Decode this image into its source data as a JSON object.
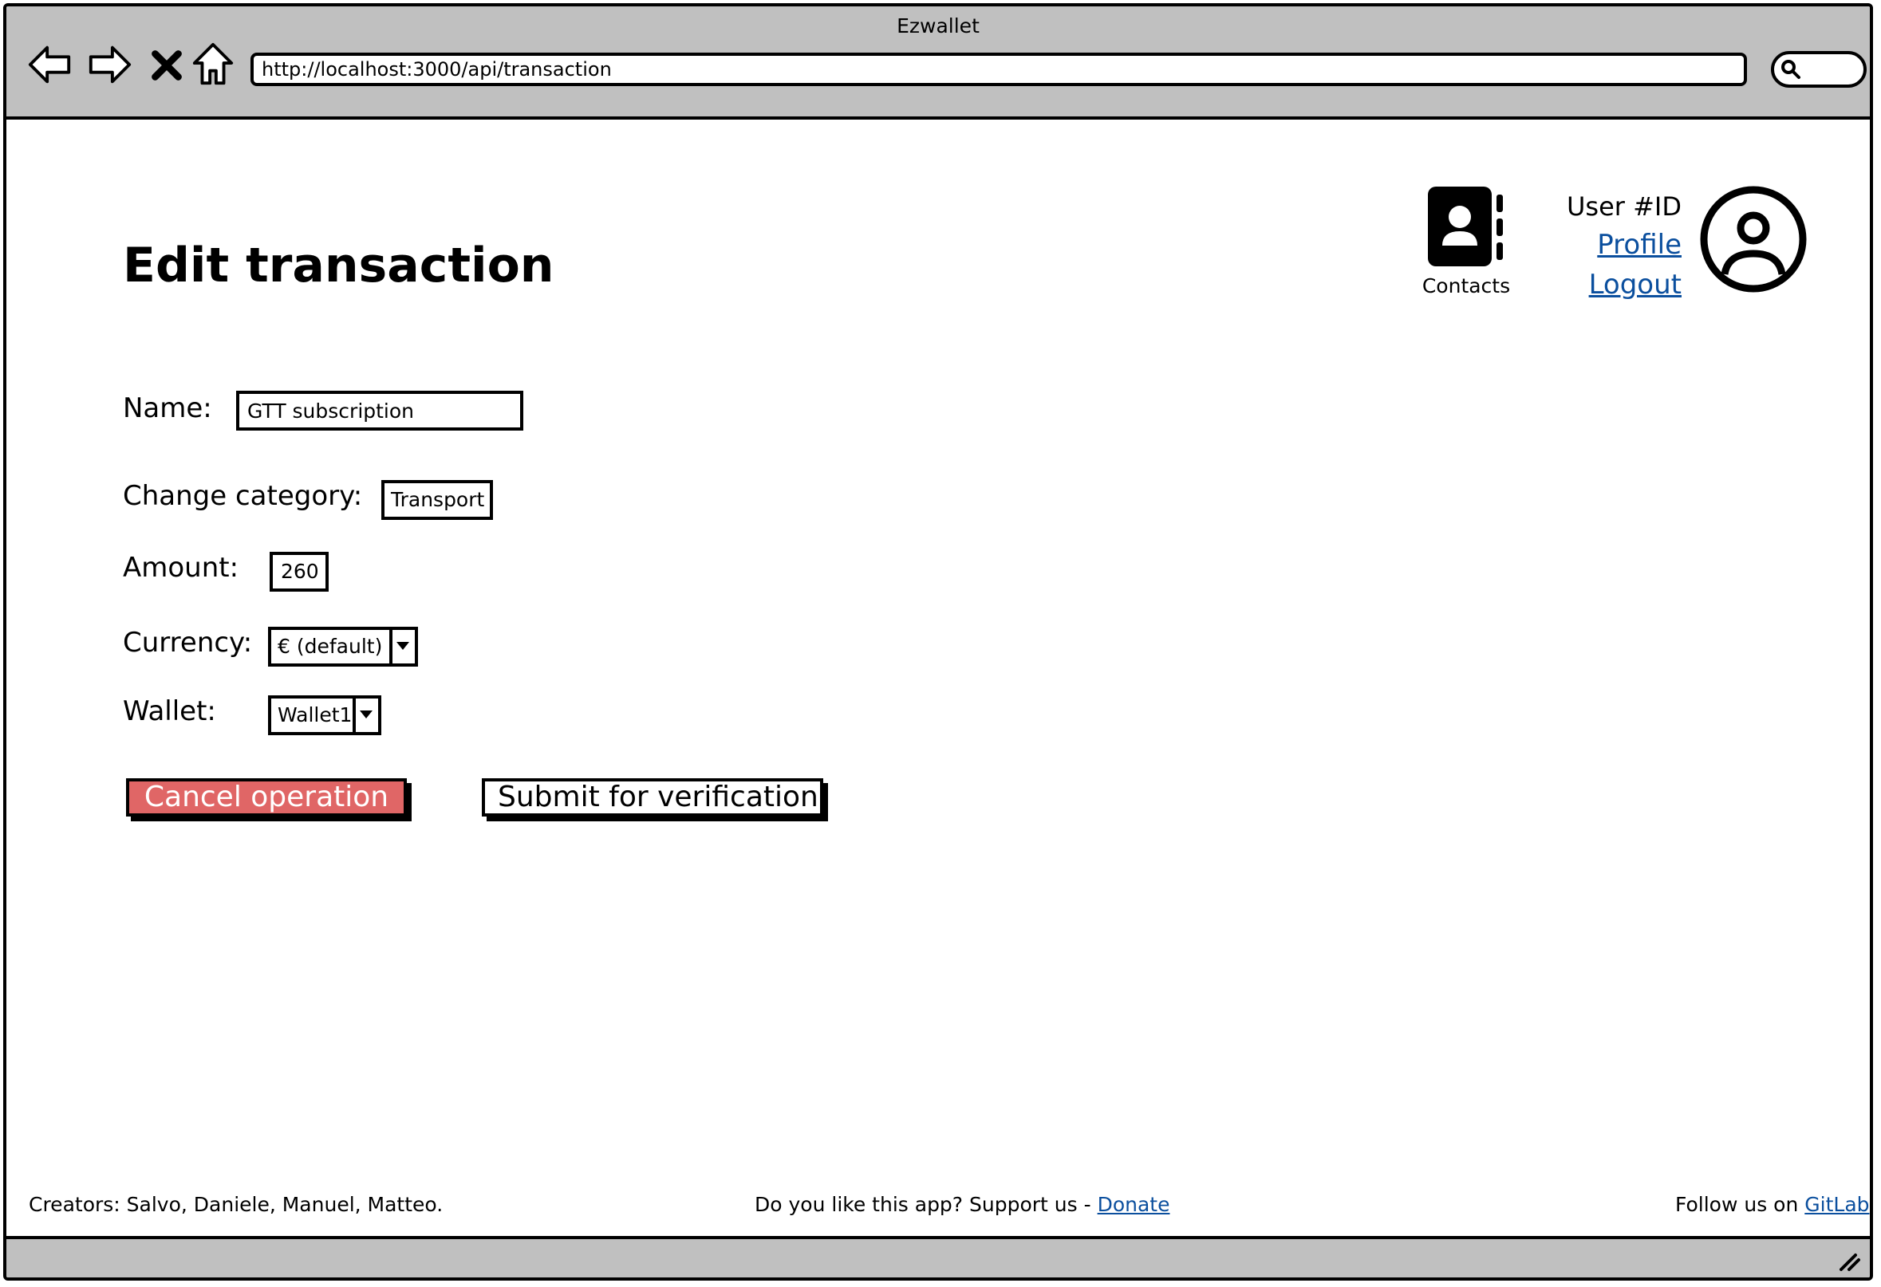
{
  "window": {
    "title": "Ezwallet",
    "url": "http://localhost:3000/api/transaction"
  },
  "header": {
    "page_title": "Edit transaction",
    "contacts_label": "Contacts",
    "user_id": "User #ID",
    "profile_link": "Profile",
    "logout_link": "Logout"
  },
  "form": {
    "name_label": "Name:",
    "name_value": "GTT subscription",
    "category_label": "Change category:",
    "category_value": "Transport",
    "amount_label": "Amount:",
    "amount_value": "260",
    "currency_label": "Currency:",
    "currency_value": "€ (default)",
    "wallet_label": "Wallet:",
    "wallet_value": "Wallet1"
  },
  "actions": {
    "cancel_label": "Cancel operation",
    "submit_label": "Submit for verification"
  },
  "footer": {
    "creators": "Creators: Salvo, Daniele, Manuel, Matteo.",
    "support_text": "Do you like this app? Support us - ",
    "donate_link": "Donate",
    "follow_text": "Follow us on ",
    "gitlab_link": "GitLab"
  },
  "colors": {
    "chrome": "#c0c0c0",
    "link": "#0b4f9e",
    "cancel_button": "#e06666"
  },
  "icons": {
    "back": "arrow-left-icon",
    "forward": "arrow-right-icon",
    "stop": "close-icon",
    "home": "home-icon",
    "search": "search-icon",
    "contacts": "address-book-icon",
    "user": "user-circle-icon",
    "resize": "resize-grip-icon"
  }
}
